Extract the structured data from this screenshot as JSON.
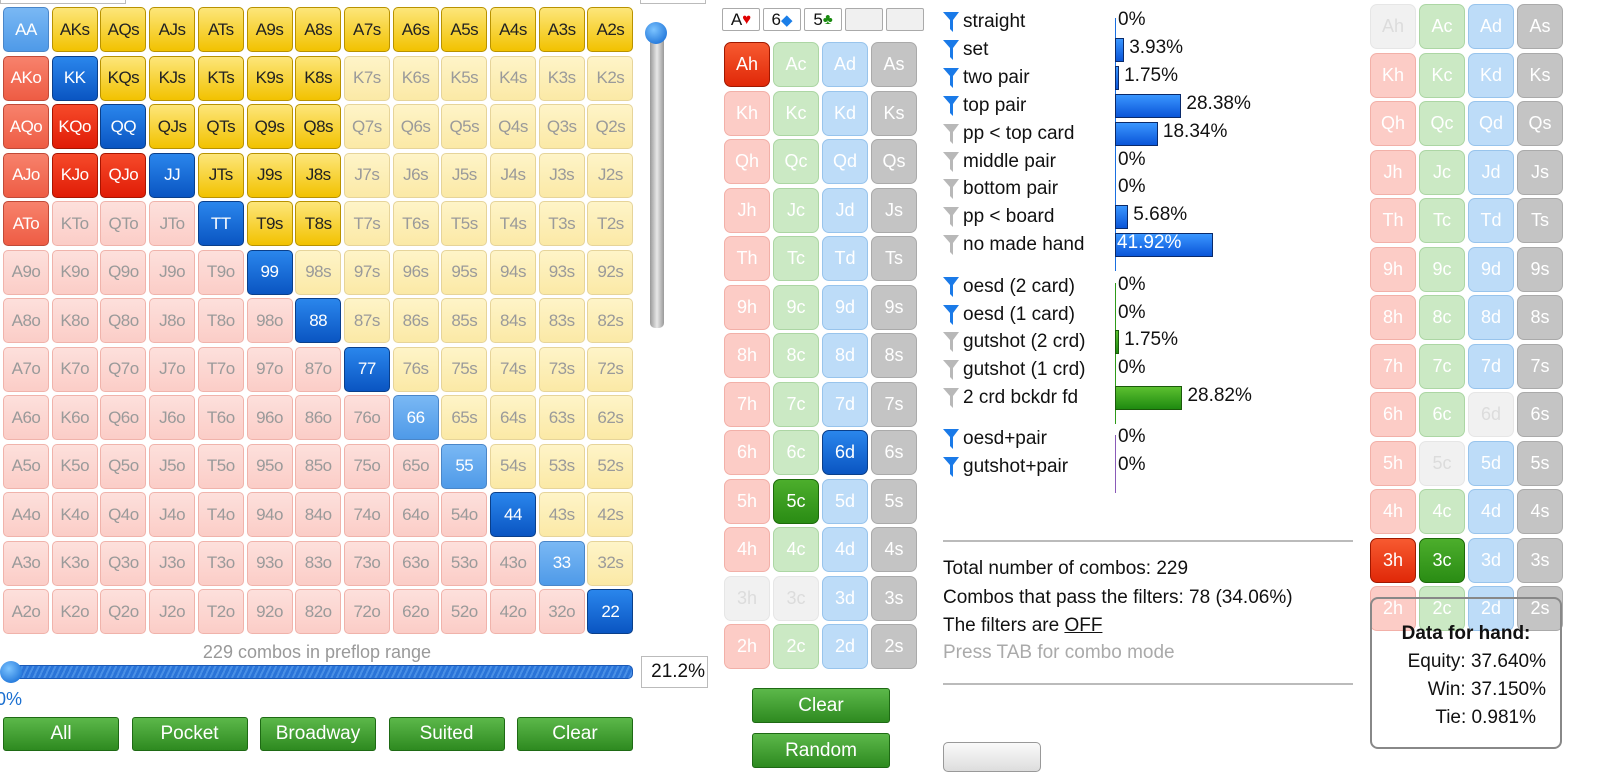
{
  "range_grid": {
    "rows": [
      {
        "cells": [
          "AA",
          "AKs",
          "AQs",
          "AJs",
          "ATs",
          "A9s",
          "A8s",
          "A7s",
          "A6s",
          "A5s",
          "A4s",
          "A3s",
          "A2s"
        ]
      },
      {
        "cells": [
          "AKo",
          "KK",
          "KQs",
          "KJs",
          "KTs",
          "K9s",
          "K8s",
          "K7s",
          "K6s",
          "K5s",
          "K4s",
          "K3s",
          "K2s"
        ]
      },
      {
        "cells": [
          "AQo",
          "KQo",
          "QQ",
          "QJs",
          "QTs",
          "Q9s",
          "Q8s",
          "Q7s",
          "Q6s",
          "Q5s",
          "Q4s",
          "Q3s",
          "Q2s"
        ]
      },
      {
        "cells": [
          "AJo",
          "KJo",
          "QJo",
          "JJ",
          "JTs",
          "J9s",
          "J8s",
          "J7s",
          "J6s",
          "J5s",
          "J4s",
          "J3s",
          "J2s"
        ]
      },
      {
        "cells": [
          "ATo",
          "KTo",
          "QTo",
          "JTo",
          "TT",
          "T9s",
          "T8s",
          "T7s",
          "T6s",
          "T5s",
          "T4s",
          "T3s",
          "T2s"
        ]
      },
      {
        "cells": [
          "A9o",
          "K9o",
          "Q9o",
          "J9o",
          "T9o",
          "99",
          "98s",
          "97s",
          "96s",
          "95s",
          "94s",
          "93s",
          "92s"
        ]
      },
      {
        "cells": [
          "A8o",
          "K8o",
          "Q8o",
          "J8o",
          "T8o",
          "98o",
          "88",
          "87s",
          "86s",
          "85s",
          "84s",
          "83s",
          "82s"
        ]
      },
      {
        "cells": [
          "A7o",
          "K7o",
          "Q7o",
          "J7o",
          "T7o",
          "97o",
          "87o",
          "77",
          "76s",
          "75s",
          "74s",
          "73s",
          "72s"
        ]
      },
      {
        "cells": [
          "A6o",
          "K6o",
          "Q6o",
          "J6o",
          "T6o",
          "96o",
          "86o",
          "76o",
          "66",
          "65s",
          "64s",
          "63s",
          "62s"
        ]
      },
      {
        "cells": [
          "A5o",
          "K5o",
          "Q5o",
          "J5o",
          "T5o",
          "95o",
          "85o",
          "75o",
          "65o",
          "55",
          "54s",
          "53s",
          "52s"
        ]
      },
      {
        "cells": [
          "A4o",
          "K4o",
          "Q4o",
          "J4o",
          "T4o",
          "94o",
          "84o",
          "74o",
          "64o",
          "54o",
          "44",
          "43s",
          "42s"
        ]
      },
      {
        "cells": [
          "A3o",
          "K3o",
          "Q3o",
          "J3o",
          "T3o",
          "93o",
          "83o",
          "73o",
          "63o",
          "53o",
          "43o",
          "33",
          "32s"
        ]
      },
      {
        "cells": [
          "A2o",
          "K2o",
          "Q2o",
          "J2o",
          "T2o",
          "92o",
          "82o",
          "72o",
          "62o",
          "52o",
          "42o",
          "32o",
          "22"
        ]
      }
    ],
    "selection_levels": [
      "1222222222222",
      "1222222000000",
      "1222222000000",
      "1222222000000",
      "1000222000000",
      "0000020000000",
      "0000002000000",
      "0000000200000",
      "0000000010000",
      "0000000001000",
      "0000000000200",
      "0000000000010",
      "0000000000002"
    ],
    "colors": {
      "pair": "#0a55c2",
      "suited": "#f2c200",
      "offsuit": "#e01c06"
    }
  },
  "range_info": {
    "combos_label": "229 combos in preflop range",
    "slider_min_label": "0%",
    "percent_value": "21.2%",
    "slider_position_percent": 0
  },
  "range_buttons": [
    "All",
    "Pocket",
    "Broadway",
    "Suited",
    "Clear"
  ],
  "board": {
    "cards": [
      {
        "rank": "A",
        "suit": "♥",
        "color": "#e00000"
      },
      {
        "rank": "6",
        "suit": "◆",
        "color": "#1a7ee8"
      },
      {
        "rank": "5",
        "suit": "♣",
        "color": "#1a8a10"
      },
      {
        "rank": "",
        "suit": "",
        "color": ""
      },
      {
        "rank": "",
        "suit": "",
        "color": ""
      }
    ]
  },
  "card_picker": {
    "ranks": [
      "A",
      "K",
      "Q",
      "J",
      "T",
      "9",
      "8",
      "7",
      "6",
      "5",
      "4",
      "3",
      "2"
    ],
    "suits": [
      "h",
      "c",
      "d",
      "s"
    ],
    "selected": [
      "Ah",
      "6d",
      "5c"
    ],
    "dead": [
      "3h",
      "3c"
    ],
    "clear_label": "Clear",
    "random_label": "Random"
  },
  "hand_picker": {
    "ranks": [
      "A",
      "K",
      "Q",
      "J",
      "T",
      "9",
      "8",
      "7",
      "6",
      "5",
      "4",
      "3",
      "2"
    ],
    "suits": [
      "h",
      "c",
      "d",
      "s"
    ],
    "selected": [
      "3h",
      "3c"
    ],
    "dead": [
      "Ah",
      "6d",
      "5c"
    ]
  },
  "filters": {
    "groups": [
      {
        "color": "#1a6fe0",
        "items": [
          {
            "label": "straight",
            "value": 0,
            "text": "0%",
            "active": true
          },
          {
            "label": "set",
            "value": 3.93,
            "text": "3.93%",
            "active": true
          },
          {
            "label": "two pair",
            "value": 1.75,
            "text": "1.75%",
            "active": true
          },
          {
            "label": "top pair",
            "value": 28.38,
            "text": "28.38%",
            "active": true
          },
          {
            "label": "pp < top card",
            "value": 18.34,
            "text": "18.34%",
            "active": false
          },
          {
            "label": "middle pair",
            "value": 0,
            "text": "0%",
            "active": false
          },
          {
            "label": "bottom pair",
            "value": 0,
            "text": "0%",
            "active": false
          },
          {
            "label": "pp < board",
            "value": 5.68,
            "text": "5.68%",
            "active": false
          },
          {
            "label": "no made hand",
            "value": 41.92,
            "text": "41.92%",
            "active": false
          }
        ]
      },
      {
        "color": "#2e9a18",
        "items": [
          {
            "label": "oesd (2 card)",
            "value": 0,
            "text": "0%",
            "active": true
          },
          {
            "label": "oesd (1 card)",
            "value": 0,
            "text": "0%",
            "active": true
          },
          {
            "label": "gutshot (2 crd)",
            "value": 1.75,
            "text": "1.75%",
            "active": false
          },
          {
            "label": "gutshot (1 crd)",
            "value": 0,
            "text": "0%",
            "active": false
          },
          {
            "label": "2 crd bckdr fd",
            "value": 28.82,
            "text": "28.82%",
            "active": false
          }
        ]
      },
      {
        "color": "#8a5ab8",
        "items": [
          {
            "label": "oesd+pair",
            "value": 0,
            "text": "0%",
            "active": true
          },
          {
            "label": "gutshot+pair",
            "value": 0,
            "text": "0%",
            "active": true
          }
        ]
      }
    ]
  },
  "summary": {
    "total": "Total number of combos: 229",
    "pass": "Combos that pass the filters: 78 (34.06%)",
    "filters_prefix": "The filters are ",
    "filters_state": "OFF",
    "hint": "Press TAB for combo mode"
  },
  "hand_data": {
    "title": "Data for hand:",
    "equity": "Equity: 37.640%",
    "win": "Win: 37.150%",
    "tie": "Tie: 0.981%"
  }
}
